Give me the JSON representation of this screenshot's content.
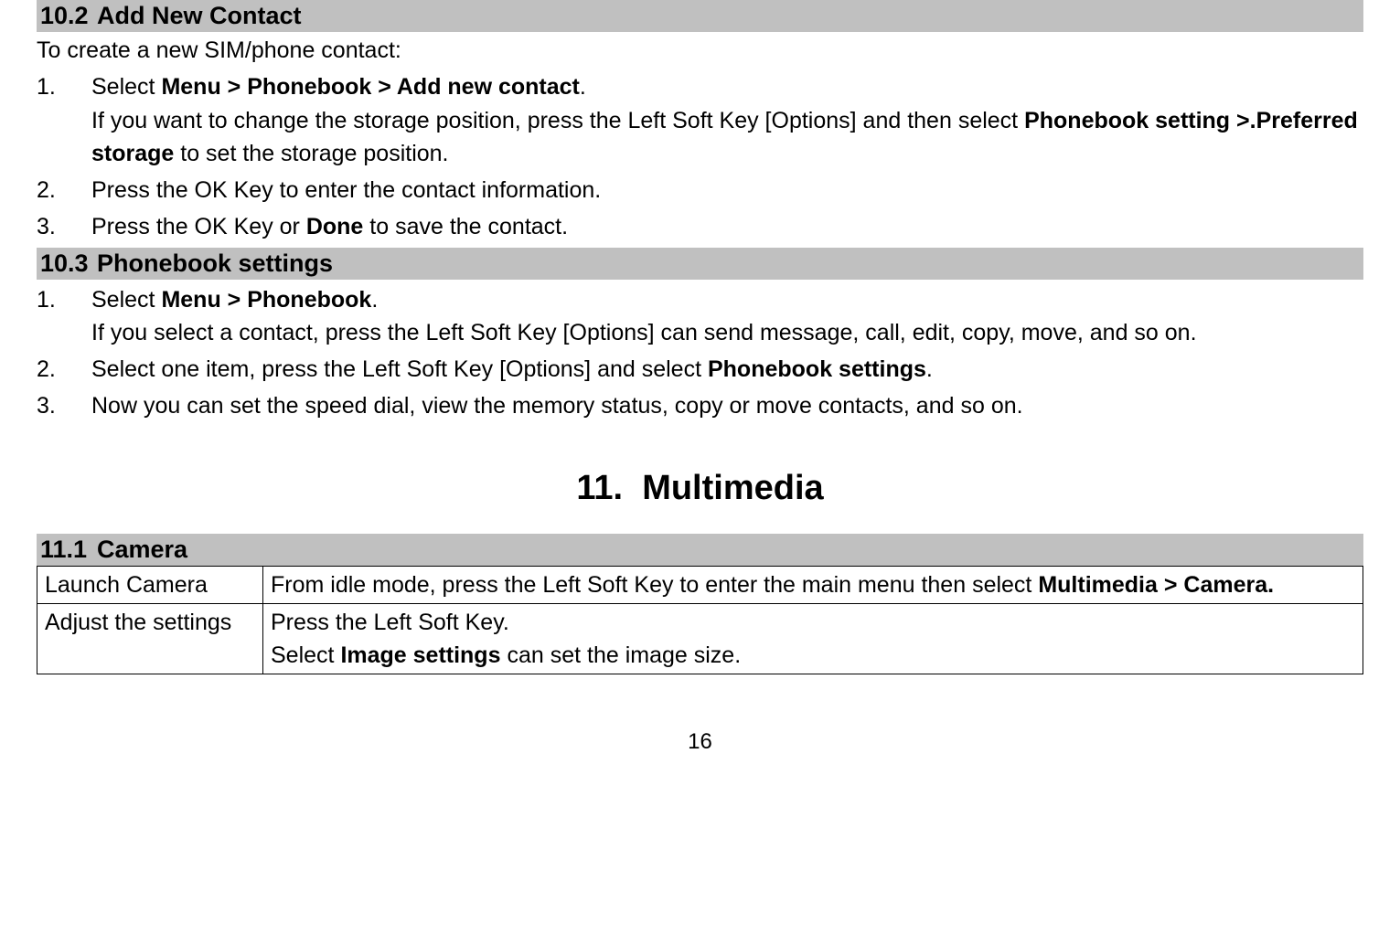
{
  "section102": {
    "number": "10.2",
    "title": "Add New Contact",
    "intro": "To create a new SIM/phone contact:",
    "items": [
      {
        "num": "1.",
        "pre": "Select ",
        "bold": "Menu > Phonebook > Add new contact",
        "post": ".",
        "sub_pre": "If you want to change the storage position, press the Left Soft Key [Options] and then select ",
        "sub_bold": "Phonebook setting >.Preferred storage",
        "sub_post": " to set the storage position."
      },
      {
        "num": "2.",
        "text": "Press the OK Key to enter the contact information."
      },
      {
        "num": "3.",
        "pre": "Press the OK Key or ",
        "bold": "Done",
        "post": " to save the contact."
      }
    ]
  },
  "section103": {
    "number": "10.3",
    "title": "Phonebook settings",
    "items": [
      {
        "num": "1.",
        "pre": "Select ",
        "bold": "Menu > Phonebook",
        "post": ".",
        "sub": "If you select a contact, press the Left Soft Key [Options] can send message, call, edit, copy, move, and so on."
      },
      {
        "num": "2.",
        "pre": "Select one item, press the Left Soft Key [Options] and select ",
        "bold": "Phonebook settings",
        "post": "."
      },
      {
        "num": "3.",
        "text": "Now you can set the speed dial, view the memory status, copy or move contacts, and so on."
      }
    ]
  },
  "chapter": {
    "number": "11.",
    "title": "Multimedia"
  },
  "section111": {
    "number": "11.1",
    "title": "Camera",
    "rows": [
      {
        "label": "Launch Camera",
        "line1_pre": "From idle mode, press the Left Soft Key to enter the main menu then select ",
        "line1_bold": "Multimedia > Camera."
      },
      {
        "label": "Adjust the settings",
        "line1": "Press the Left Soft Key.",
        "line2_pre": "Select ",
        "line2_bold": "Image settings",
        "line2_post": " can set the image size."
      }
    ]
  },
  "page_number": "16"
}
